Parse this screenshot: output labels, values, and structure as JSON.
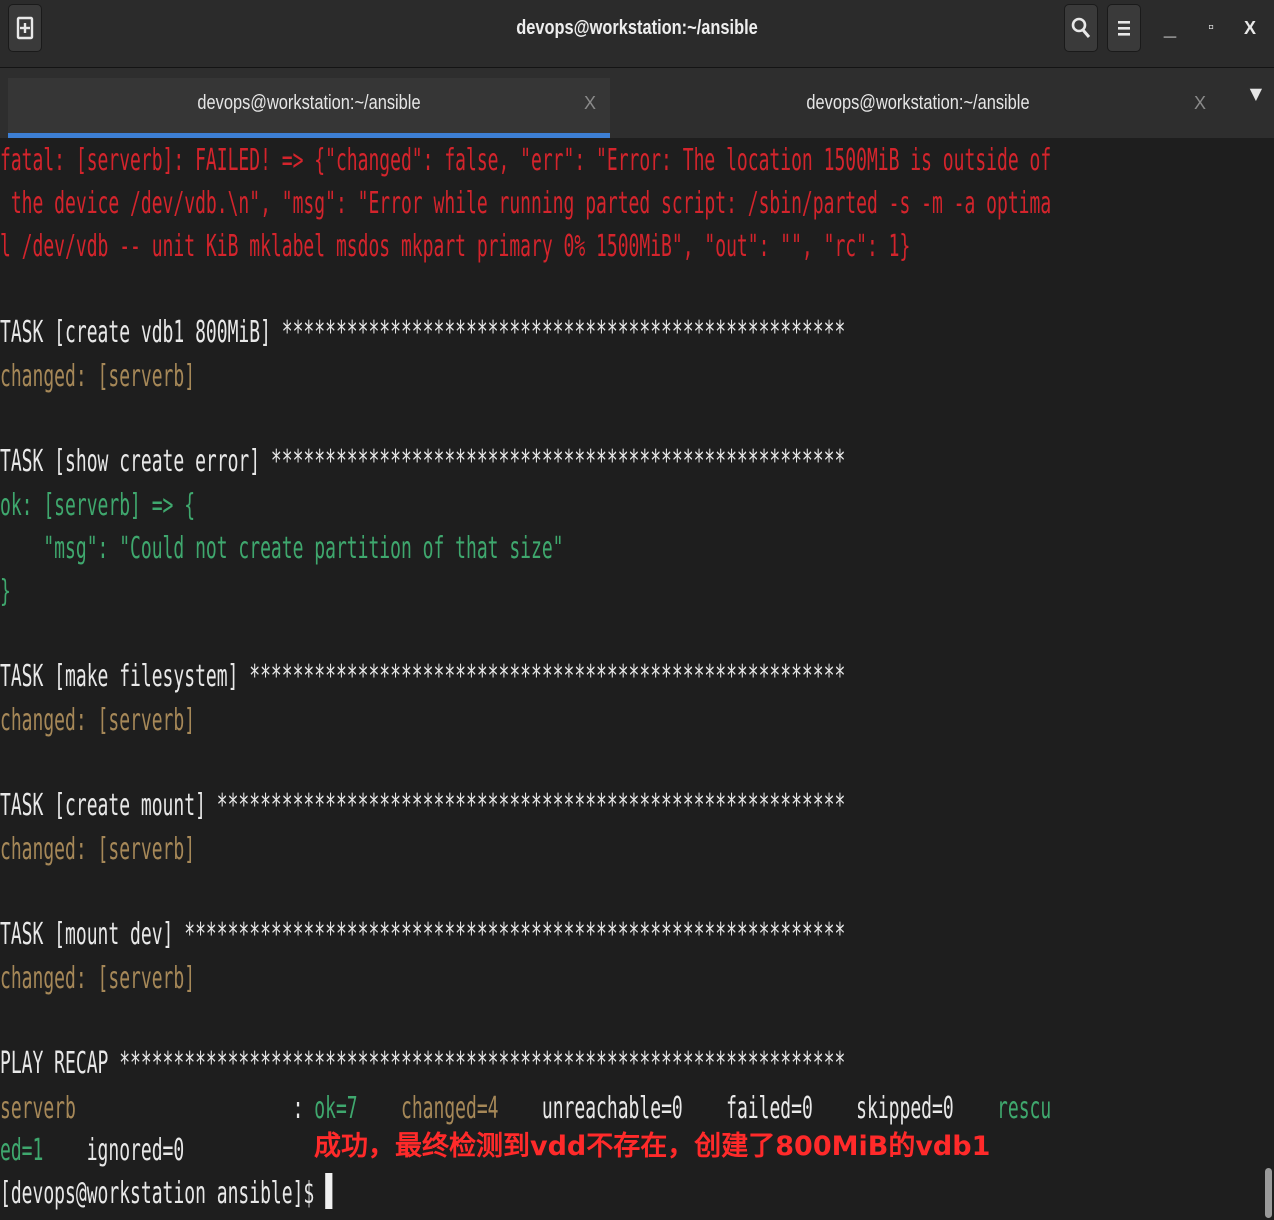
{
  "window": {
    "title": "devops@workstation:~/ansible",
    "controls": {
      "minimize": "_",
      "maximize": "▫",
      "close": "X"
    }
  },
  "tabs": [
    {
      "label": "devops@workstation:~/ansible",
      "close": "X",
      "active": true
    },
    {
      "label": "devops@workstation:~/ansible",
      "close": "X",
      "active": false
    }
  ],
  "icons": {
    "new_tab": "new-tab-icon",
    "search": "search-icon",
    "menu": "hamburger-menu-icon",
    "tab_dropdown": "chevron-down-icon"
  },
  "colors": {
    "background": "#1e1e1e",
    "error": "#d4242c",
    "changed": "#a68858",
    "ok": "#3fa86e",
    "text": "#e8e8e8",
    "annotation": "#ff2a2a",
    "tab_accent": "#3d7fd4"
  },
  "terminal": {
    "fatal": [
      "fatal: [serverb]: FAILED! => {\"changed\": false, \"err\": \"Error: The location 1500MiB is outside of",
      " the device /dev/vdb.\\n\", \"msg\": \"Error while running parted script: /sbin/parted -s -m -a optima",
      "l /dev/vdb -- unit KiB mklabel msdos mkpart primary 0% 1500MiB\", \"out\": \"\", \"rc\": 1}"
    ],
    "task_create_vdb1": "TASK [create vdb1 800MiB] ****************************************************",
    "changed_1": "changed: [serverb]",
    "task_show_error": "TASK [show create error] *****************************************************",
    "ok_line": "ok: [serverb] => {",
    "msg_line": "    \"msg\": \"Could not create partition of that size\"",
    "close_brace": "}",
    "task_make_fs": "TASK [make filesystem] *******************************************************",
    "changed_2": "changed: [serverb]",
    "task_create_mount": "TASK [create mount] **********************************************************",
    "changed_3": "changed: [serverb]",
    "task_mount_dev": "TASK [mount dev] *************************************************************",
    "changed_4": "changed: [serverb]",
    "play_recap": "PLAY RECAP *******************************************************************",
    "recap": {
      "host": "serverb",
      "sep": "                    : ",
      "ok": "ok=7",
      "gap1": "    ",
      "changed": "changed=4",
      "gap2": "    ",
      "unreachable": "unreachable=0",
      "gap3": "    ",
      "failed": "failed=0",
      "gap4": "    ",
      "skipped": "skipped=0",
      "gap5": "    ",
      "rescued_part1": "rescu",
      "rescued_part2": "ed=1",
      "gap6": "    ",
      "ignored": "ignored=0"
    },
    "prompt": "[devops@workstation ansible]$ "
  },
  "annotation": "成功，最终检测到vdd不存在，创建了800MiB的vdb1"
}
